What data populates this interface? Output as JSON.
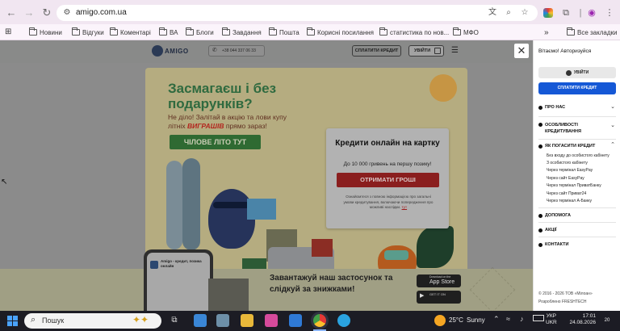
{
  "browser": {
    "url": "amigo.com.ua",
    "bookmarks": [
      "Новини",
      "Відгуки",
      "Коментарі",
      "ВА",
      "Блоги",
      "Завдання",
      "Пошта",
      "Корисні посилання",
      "статистика по нов...",
      "МФО"
    ],
    "all_bookmarks": "Все закладки",
    "overflow": "»"
  },
  "site": {
    "logo_text": "AMIGO",
    "phone": "+38 044 337 06 33",
    "pay_button": "СПЛАТИТИ КРЕДИТ",
    "login_button": "УВІЙТИ"
  },
  "promo": {
    "title": "Засмагаєш і без подарунків?",
    "text_part1": "Не діло! Залітай в акцію та лови купу літніх ",
    "text_highlight": "ВИГРАШІВ",
    "text_part2": " прямо зараз!",
    "button": "ЧІЛОВЕ ЛІТО ТУТ"
  },
  "credit": {
    "title": "Кредити онлайн на картку",
    "subtitle": "До 10 000 гривень на першу позику!",
    "button": "ОТРИМАТИ ГРОШІ",
    "note": "Ознайомтеся з повною інформацією про загальні умови кредитування, включаючи попередження про можливі наслідки.",
    "note_link": "тут"
  },
  "download": {
    "text": "Завантажуй наш застосунок та слідкуй за знижками!",
    "phone_text": "Amigo - кредит, позика онлайн",
    "appstore_small": "Download on the",
    "appstore": "App Store",
    "googleplay_small": "GET IT ON"
  },
  "panel": {
    "greeting": "Вітаємо! Авторизуйся",
    "login": "УВІЙТИ",
    "pay": "СПЛАТИТИ КРЕДИТ",
    "items": [
      {
        "label": "ПРО НАС"
      },
      {
        "label": "ОСОБЛИВОСТІ КРЕДИТУВАННЯ"
      },
      {
        "label": "ЯК ПОГАСИТИ КРЕДИТ"
      }
    ],
    "sub_items": [
      "Без входу до особистого кабінету",
      "З особистого кабінету",
      "Через термінал EasyPay",
      "Через сайт EasyPay",
      "Через термінал ПриватБанку",
      "Через сайт Приват24",
      "Через термінал А-Банку"
    ],
    "links": [
      "ДОПОМОГА",
      "АКЦІЇ",
      "КОНТАКТИ"
    ],
    "copyright": "© 2016 - 2026 ТОВ «Мілоан»",
    "developer": "Розроблено FRESHTECH"
  },
  "taskbar": {
    "search_placeholder": "Пошук",
    "weather_temp": "25°C",
    "weather_text": "Sunny",
    "lang1": "УКР",
    "lang2": "UKR",
    "time": "17:01",
    "date": "24.08.2026",
    "notif_count": "20"
  }
}
